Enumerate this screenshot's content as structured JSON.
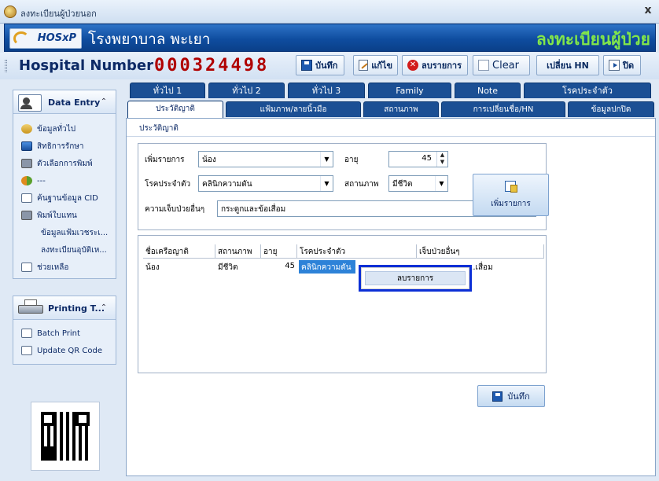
{
  "window": {
    "title": "ลงทะเบียนผู้ป่วยนอก",
    "close": "x"
  },
  "banner": {
    "logo_text": "HOSxP",
    "hospital_name": "โรงพยาบาล พะเยา",
    "heading": "ลงทะเบียนผู้ป่วย"
  },
  "toolbar": {
    "hn_label": "Hospital Number",
    "hn_value": "000324498",
    "save": "บันทึก",
    "edit": "แก้ไข",
    "delete": "ลบรายการ",
    "clear": "Clear",
    "change_hn": "เปลี่ยน HN",
    "close": "ปิด"
  },
  "sidebar": {
    "data_entry": {
      "title": "Data Entry",
      "items": [
        {
          "label": "ข้อมูลทั่วไป",
          "icon": "info-icon"
        },
        {
          "label": "สิทธิการรักษา",
          "icon": "rights-icon"
        },
        {
          "label": "ตัวเลือกการพิมพ์",
          "icon": "print-option-icon"
        },
        {
          "label": "---",
          "icon": "people-icon"
        },
        {
          "label": "ค้นฐานข้อมูล CID",
          "icon": "search-cid-icon"
        },
        {
          "label": "พิมพ์ใบแทน",
          "icon": "printer-icon"
        },
        {
          "label": "ข้อมูลแฟ้มเวชระเ...",
          "icon": ""
        },
        {
          "label": "ลงทะเบียนอุบัติเห...",
          "icon": ""
        },
        {
          "label": "ช่วยเหลือ",
          "icon": "help-icon"
        }
      ]
    },
    "printing": {
      "title": "Printing T...",
      "items": [
        {
          "label": "Batch Print",
          "icon": "batch-print-icon"
        },
        {
          "label": "Update QR Code",
          "icon": "qr-update-icon"
        }
      ]
    }
  },
  "tabs": {
    "row1": [
      "ทั่วไป 1",
      "ทั่วไป 2",
      "ทั่วไป 3",
      "Family",
      "Note",
      "โรคประจำตัว"
    ],
    "row2": [
      "ประวัติญาติ",
      "แฟ้มภาพ/ลายนิ้วมือ",
      "สถานภาพ",
      "การเปลี่ยนชื่อ/HN",
      "ข้อมูลปกปิด"
    ],
    "active": "ประวัติญาติ"
  },
  "section_title": "ประวัติญาติ",
  "form": {
    "add_item_label": "เพิ่มรายการ",
    "add_item_value": "น้อง",
    "age_label": "อายุ",
    "age_value": "45",
    "disease_label": "โรคประจำตัว",
    "disease_value": "คลินิกความดัน",
    "status_label": "สถานภาพ",
    "status_value": "มีชีวิต",
    "other_label": "ความเจ็บป่วยอื่นๆ",
    "other_value": "กระดูกและข้อเสื่อม",
    "add_button": "เพิ่มรายการ"
  },
  "grid": {
    "headers": [
      "ชื่อเครือญาติ",
      "สถานภาพ",
      "อายุ",
      "โรคประจำตัว",
      "เจ็บป่วยอื่นๆ"
    ],
    "rows": [
      [
        "น้อง",
        "มีชีวิต",
        "45",
        "คลินิกความดัน",
        "...เสื่อม"
      ]
    ]
  },
  "context_menu": {
    "item": "ลบรายการ"
  },
  "save_button": "บันทึก",
  "colors": {
    "banner": "#0f4da0",
    "heading": "#82e64a",
    "hn": "#b00000",
    "tab": "#1b4f94",
    "selection": "#2d82d8",
    "menu_border": "#0c2fd6"
  }
}
